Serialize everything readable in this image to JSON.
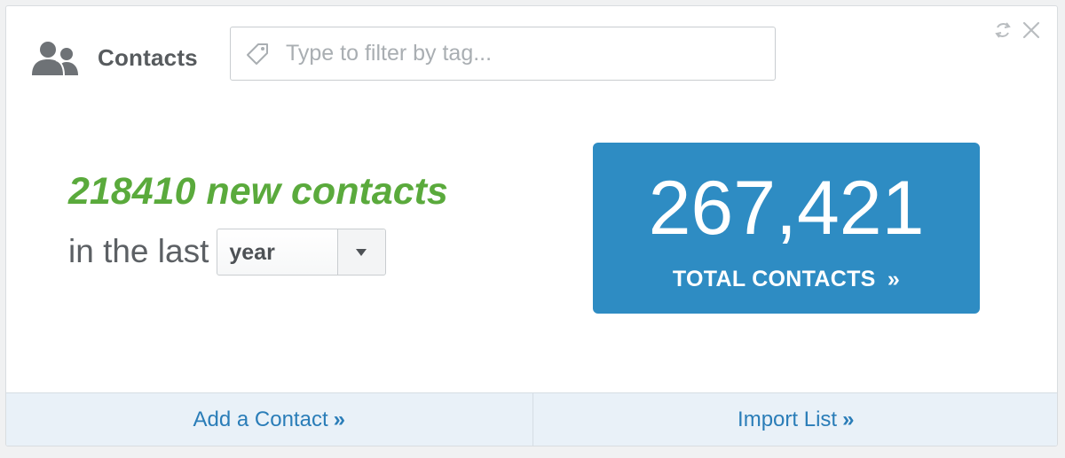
{
  "header": {
    "title": "Contacts",
    "icon": "contacts-icon"
  },
  "filter": {
    "placeholder": "Type to filter by tag...",
    "value": "",
    "icon": "tag-icon"
  },
  "controls": {
    "refresh_icon": "refresh-icon",
    "close_icon": "close-icon"
  },
  "stats": {
    "new_contacts_text": "218410 new contacts",
    "period_prefix": "in the last",
    "period_value": "year"
  },
  "total": {
    "number": "267,421",
    "label": "TOTAL CONTACTS",
    "chevron": "»"
  },
  "footer": {
    "add_label": "Add a Contact",
    "import_label": "Import List",
    "chevron": "»"
  },
  "colors": {
    "accent_green": "#5aaa3c",
    "total_blue": "#2e8cc3",
    "link_blue": "#2a7db8",
    "footer_bg": "#e9f1f8"
  }
}
